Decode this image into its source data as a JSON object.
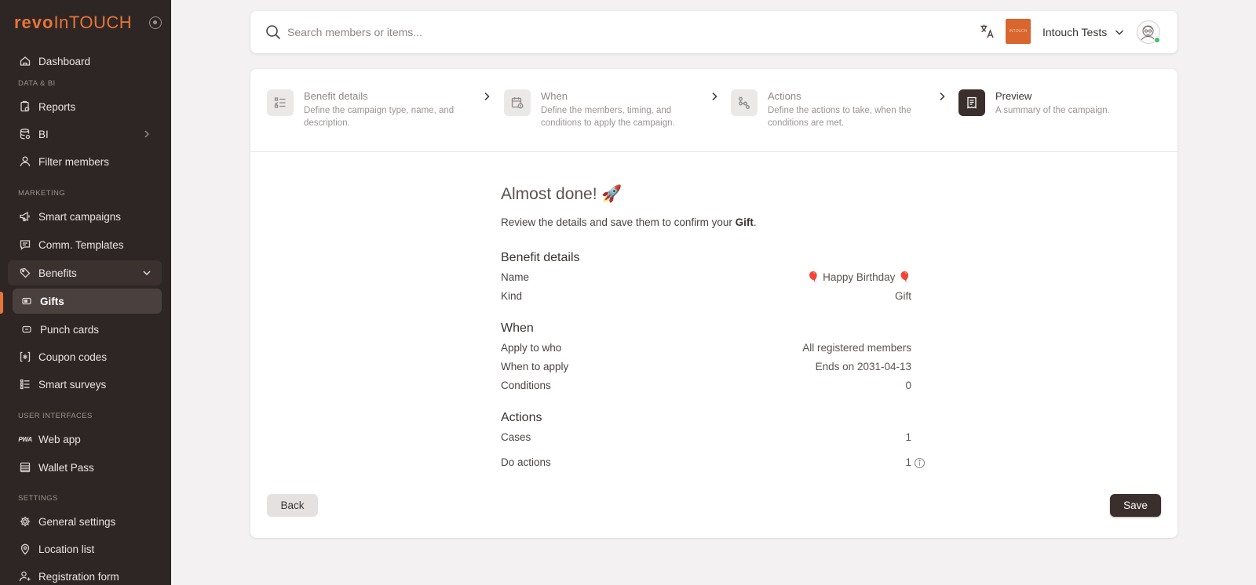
{
  "brand": {
    "logo_revo": "revo",
    "logo_intouch": "InTOUCH",
    "accent": "#e8743b"
  },
  "sidebar": {
    "items": [
      {
        "label": "Dashboard",
        "icon": "home-icon"
      },
      {
        "section": "DATA & BI"
      },
      {
        "label": "Reports",
        "icon": "reports-icon"
      },
      {
        "label": "BI",
        "icon": "database-icon"
      },
      {
        "label": "Filter members",
        "icon": "user-icon"
      },
      {
        "section": "MARKETING"
      },
      {
        "label": "Smart campaigns",
        "icon": "megaphone-icon"
      },
      {
        "label": "Comm. Templates",
        "icon": "chat-icon"
      },
      {
        "label": "Benefits",
        "icon": "tag-icon"
      },
      {
        "label": "Gifts",
        "icon": "gift-card-icon"
      },
      {
        "label": "Punch cards",
        "icon": "card-icon"
      },
      {
        "label": "Coupon codes",
        "icon": "coupon-icon"
      },
      {
        "label": "Smart surveys",
        "icon": "list-icon"
      },
      {
        "section": "USER INTERFACES"
      },
      {
        "label": "Web app",
        "icon": "pwa-icon"
      },
      {
        "label": "Wallet Pass",
        "icon": "wallet-icon"
      },
      {
        "section": "SETTINGS"
      },
      {
        "label": "General settings",
        "icon": "gear-icon"
      },
      {
        "label": "Location list",
        "icon": "location-pin-icon"
      },
      {
        "label": "Registration form",
        "icon": "add-user-icon"
      }
    ],
    "pwa_glyph": "PWA"
  },
  "topbar": {
    "search_placeholder": "Search members or items...",
    "org_name": "Intouch Tests",
    "brand_thumb_text": "INTOUCH"
  },
  "stepper": {
    "steps": [
      {
        "title": "Benefit details",
        "desc": "Define the campaign type, name, and description."
      },
      {
        "title": "When",
        "desc": "Define the members, timing, and conditions to apply the campaign."
      },
      {
        "title": "Actions",
        "desc": "Define the actions to take, when the conditions are met."
      },
      {
        "title": "Preview",
        "desc": "A summary of the campaign."
      }
    ]
  },
  "preview": {
    "headline": "Almost done! 🚀",
    "sub_prefix": "Review the details and save them to confirm your ",
    "sub_bold": "Gift",
    "sub_suffix": ".",
    "benefit_title": "Benefit details",
    "name_label": "Name",
    "name_value": "🎈 Happy Birthday 🎈",
    "kind_label": "Kind",
    "kind_value": "Gift",
    "when_title": "When",
    "apply_label": "Apply to who",
    "apply_value": "All registered members",
    "when_label": "When to apply",
    "when_value": "Ends on 2031-04-13",
    "conditions_label": "Conditions",
    "conditions_value": "0",
    "actions_title": "Actions",
    "cases_label": "Cases",
    "cases_value": "1",
    "do_label": "Do actions",
    "do_value": "1"
  },
  "buttons": {
    "back": "Back",
    "save": "Save"
  }
}
